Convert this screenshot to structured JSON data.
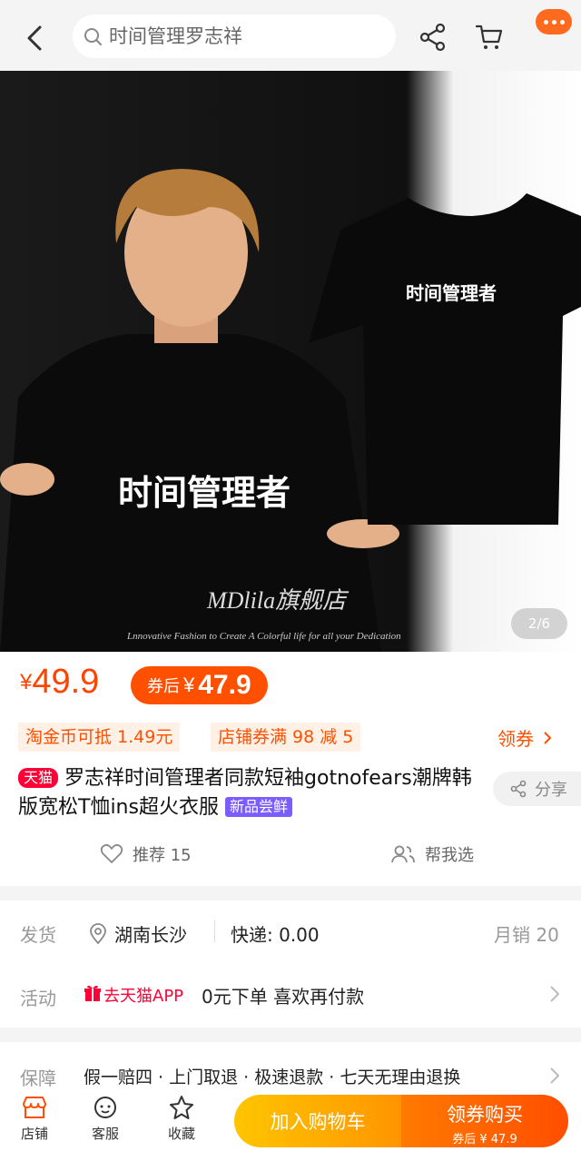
{
  "header": {
    "search_text": "时间管理罗志祥"
  },
  "gallery": {
    "counter": "2/6",
    "shirt_print": "时间管理者",
    "brand_watermark": "MDlila旗舰店",
    "tagline": "Lnnovative Fashion to Create A Colorful life for all your Dedication"
  },
  "price": {
    "symbol": "¥",
    "value": "49.9",
    "coupon_label": "券后",
    "coupon_symbol": "¥",
    "coupon_value": "47.9"
  },
  "promos": {
    "coins": "淘金币可抵 1.49元",
    "store_coupon": "店铺券满 98 减 5",
    "claim": "领券"
  },
  "product": {
    "tmall_tag": "天猫",
    "title": "罗志祥时间管理者同款短袖gotnofears潮牌韩版宽松T恤ins超火衣服",
    "new_tag": "新品尝鲜",
    "share": "分享",
    "recommend": "推荐 15",
    "help_choose": "帮我选"
  },
  "shipping": {
    "label": "发货",
    "location": "湖南长沙",
    "express": "快递: 0.00",
    "sales": "月销 20"
  },
  "activity": {
    "label": "活动",
    "tag": "去天猫APP",
    "text": "0元下单 喜欢再付款"
  },
  "guarantee": {
    "label": "保障",
    "text": "假一赔四 · 上门取退 · 极速退款 · 七天无理由退换"
  },
  "bottom": {
    "store": "店铺",
    "service": "客服",
    "favorite": "收藏",
    "add_cart": "加入购物车",
    "buy_main": "领券购买",
    "buy_sub": "券后 ¥ 47.9"
  },
  "colors": {
    "accent": "#ff5000",
    "price": "#ff4400",
    "tmall": "#ff0036"
  }
}
